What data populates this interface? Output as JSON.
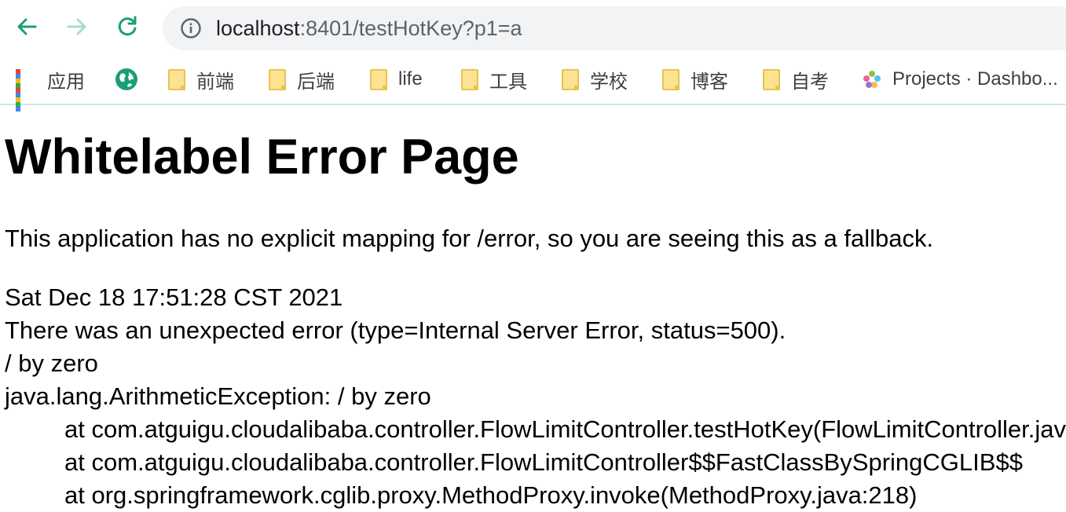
{
  "browser": {
    "url_host": "localhost",
    "url_rest": ":8401/testHotKey?p1=a",
    "colors": {
      "nav_active": "#1a9e77",
      "nav_disabled": "#a8ddc9",
      "omnibox_bg": "#f1f3f4"
    }
  },
  "bookmarks": {
    "items": [
      {
        "label": "应用",
        "icon": "apps-grid-icon"
      },
      {
        "label": "",
        "icon": "globe-icon"
      },
      {
        "label": "前端",
        "icon": "folder-icon"
      },
      {
        "label": "后端",
        "icon": "folder-icon"
      },
      {
        "label": "life",
        "icon": "folder-icon"
      },
      {
        "label": "工具",
        "icon": "folder-icon"
      },
      {
        "label": "学校",
        "icon": "folder-icon"
      },
      {
        "label": "博客",
        "icon": "folder-icon"
      },
      {
        "label": "自考",
        "icon": "folder-icon"
      },
      {
        "label": "Projects · Dashbo...",
        "icon": "flower-icon"
      }
    ]
  },
  "page": {
    "title": "Whitelabel Error Page",
    "message": "This application has no explicit mapping for /error, so you are seeing this as a fallback.",
    "timestamp": "Sat Dec 18 17:51:28 CST 2021",
    "error_line": "There was an unexpected error (type=Internal Server Error, status=500).",
    "cause": "/ by zero",
    "exception": "java.lang.ArithmeticException: / by zero",
    "stack_trace": [
      "at com.atguigu.cloudalibaba.controller.FlowLimitController.testHotKey(FlowLimitController.java:",
      "at com.atguigu.cloudalibaba.controller.FlowLimitController$$FastClassBySpringCGLIB$$",
      "at org.springframework.cglib.proxy.MethodProxy.invoke(MethodProxy.java:218)"
    ]
  }
}
